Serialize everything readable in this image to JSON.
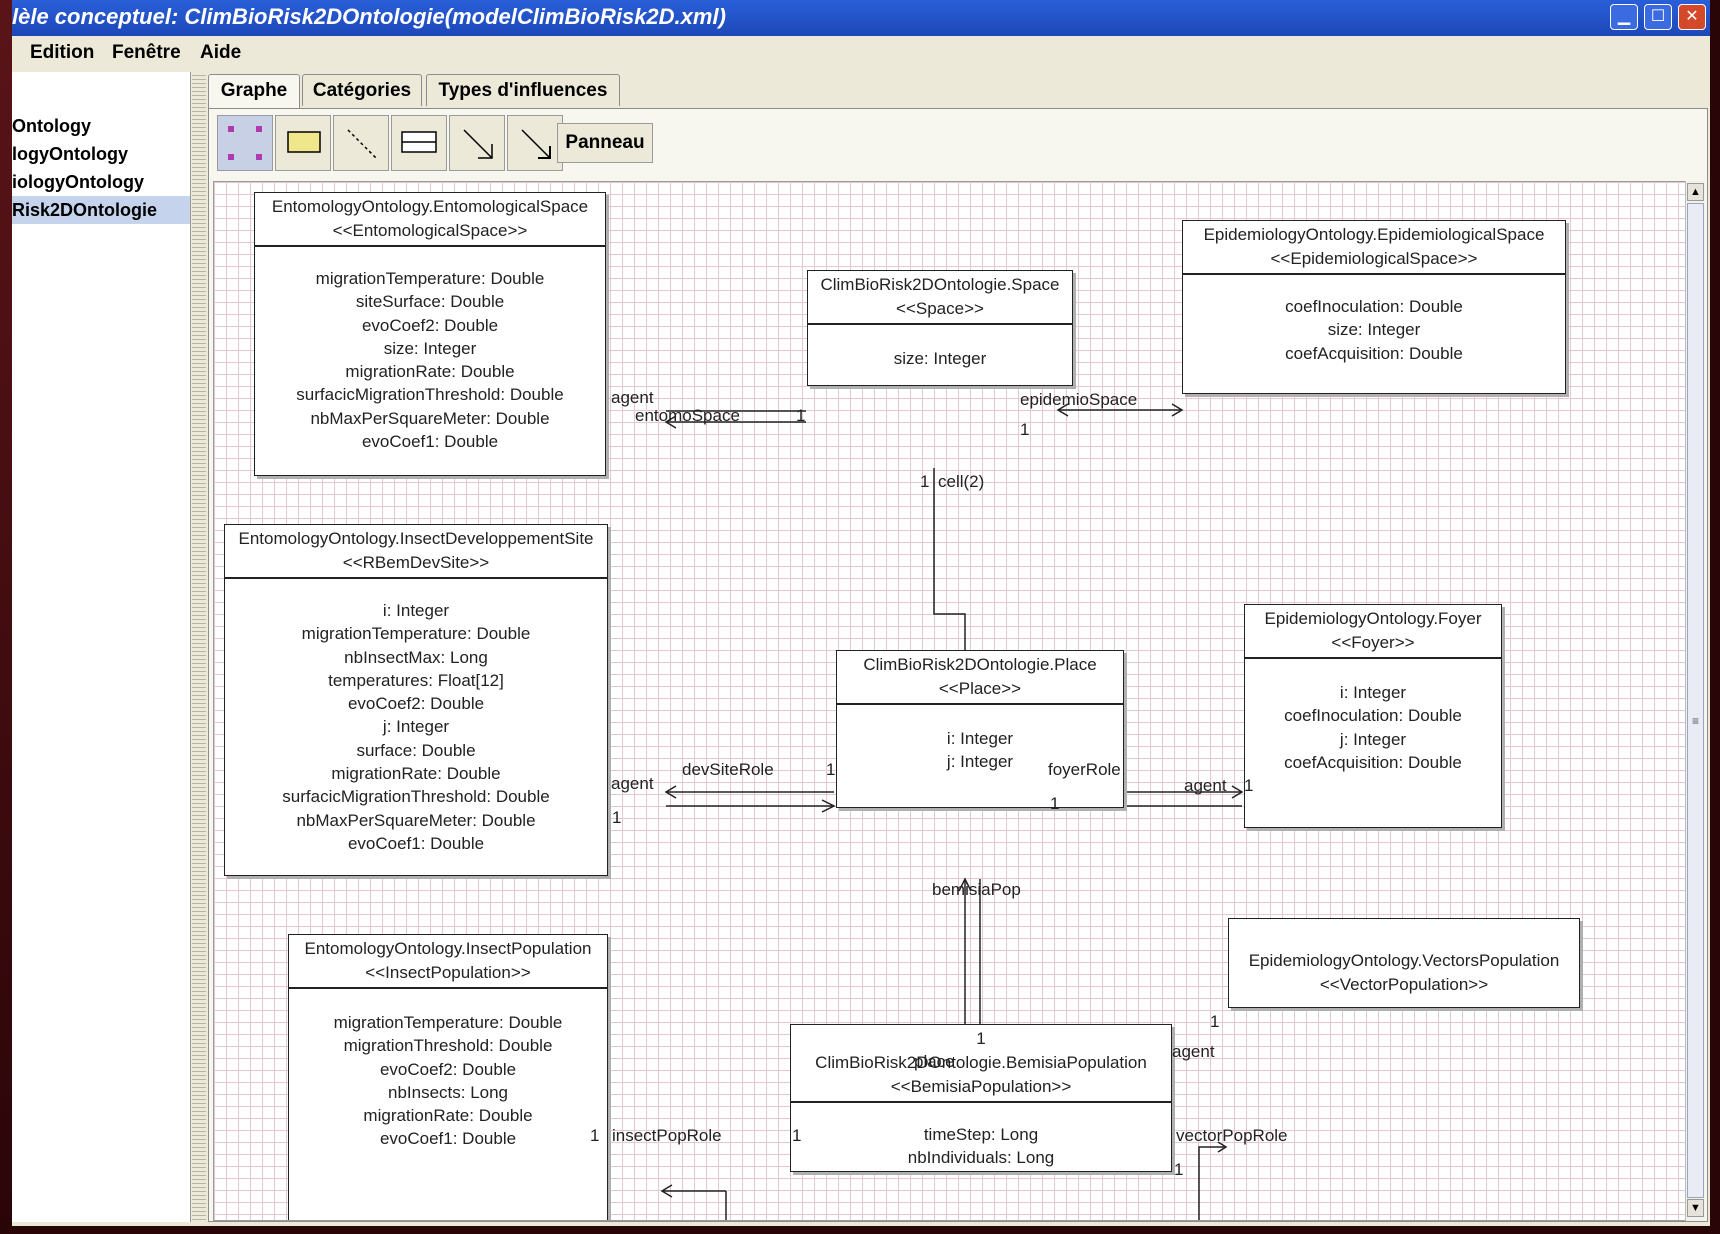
{
  "window": {
    "title": "lèle conceptuel: ClimBioRisk2DOntologie(modelClimBioRisk2D.xml)"
  },
  "menu": [
    "Edition",
    "Fenêtre",
    "Aide"
  ],
  "tree": [
    "Ontology",
    "logyOntology",
    "iologyOntology",
    "Risk2DOntologie"
  ],
  "tabs": [
    "Graphe",
    "Catégories",
    "Types d'influences"
  ],
  "toolbar": {
    "panneau_label": "Panneau"
  },
  "classes": {
    "entomoSpace": {
      "name": "EntomologyOntology.EntomologicalSpace",
      "stereo": "<<EntomologicalSpace>>",
      "attrs": [
        "migrationTemperature: Double",
        "siteSurface: Double",
        "evoCoef2: Double",
        "size: Integer",
        "migrationRate: Double",
        "surfacicMigrationThreshold: Double",
        "nbMaxPerSquareMeter: Double",
        "evoCoef1: Double"
      ]
    },
    "space": {
      "name": "ClimBioRisk2DOntologie.Space",
      "stereo": "<<Space>>",
      "attrs": [
        "size: Integer"
      ]
    },
    "epidemioSpace": {
      "name": "EpidemiologyOntology.EpidemiologicalSpace",
      "stereo": "<<EpidemiologicalSpace>>",
      "attrs": [
        "coefInoculation: Double",
        "size: Integer",
        "coefAcquisition: Double"
      ]
    },
    "devSite": {
      "name": "EntomologyOntology.InsectDeveloppementSite",
      "stereo": "<<RBemDevSite>>",
      "attrs": [
        "i: Integer",
        "migrationTemperature: Double",
        "nbInsectMax: Long",
        "temperatures: Float[12]",
        "evoCoef2: Double",
        "j: Integer",
        "surface: Double",
        "migrationRate: Double",
        "surfacicMigrationThreshold: Double",
        "nbMaxPerSquareMeter: Double",
        "evoCoef1: Double"
      ]
    },
    "place": {
      "name": "ClimBioRisk2DOntologie.Place",
      "stereo": "<<Place>>",
      "attrs": [
        "i: Integer",
        "j: Integer"
      ]
    },
    "foyer": {
      "name": "EpidemiologyOntology.Foyer",
      "stereo": "<<Foyer>>",
      "attrs": [
        "i: Integer",
        "coefInoculation: Double",
        "j: Integer",
        "coefAcquisition: Double"
      ]
    },
    "insectPop": {
      "name": "EntomologyOntology.InsectPopulation",
      "stereo": "<<InsectPopulation>>",
      "attrs": [
        "migrationTemperature: Double",
        "migrationThreshold: Double",
        "evoCoef2: Double",
        "nbInsects: Long",
        "migrationRate: Double",
        "evoCoef1: Double"
      ]
    },
    "vectorsPop": {
      "name": "EpidemiologyOntology.VectorsPopulation",
      "stereo": "<<VectorPopulation>>",
      "attrs": []
    },
    "bemisiaPop": {
      "name": "ClimBioRisk2DOntologie.BemisiaPopulation",
      "stereo": "<<BemisiaPopulation>>",
      "attrs": [
        "timeStep: Long",
        "nbIndividuals: Long"
      ]
    }
  },
  "labels": {
    "agent": "agent",
    "entomoSpace": "entomoSpace",
    "epidemioSpace": "epidemioSpace",
    "cell": "cell(2)",
    "devSiteRole": "devSiteRole",
    "foyerRole": "foyerRole",
    "bemisiaPop": "bemisiaPop",
    "place": "place",
    "insectPopRole": "insectPopRole",
    "vectorPopRole": "vectorPopRole",
    "one": "1"
  }
}
